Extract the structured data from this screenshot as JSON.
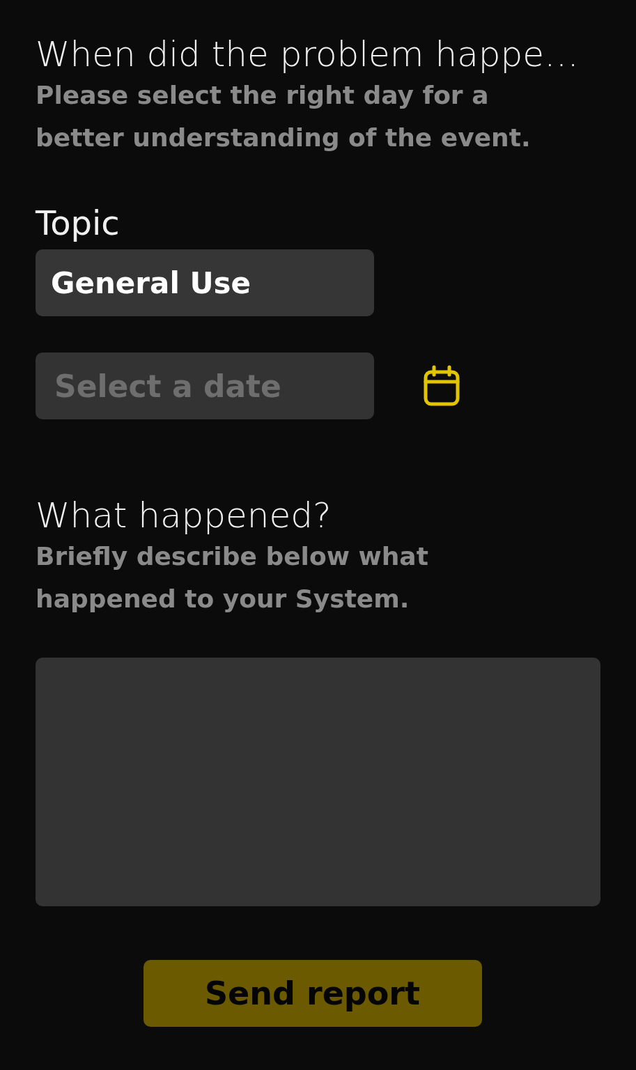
{
  "date_section": {
    "title": "When did the problem happe…",
    "description": "Please select the right day for a better understanding of the event."
  },
  "topic": {
    "label": "Topic",
    "value": "General Use"
  },
  "date_field": {
    "placeholder": "Select a date"
  },
  "details_section": {
    "title": "What happened?",
    "description": "Briefly describe below what happened to your System."
  },
  "send_button": {
    "label": "Send report",
    "disabled": true
  }
}
